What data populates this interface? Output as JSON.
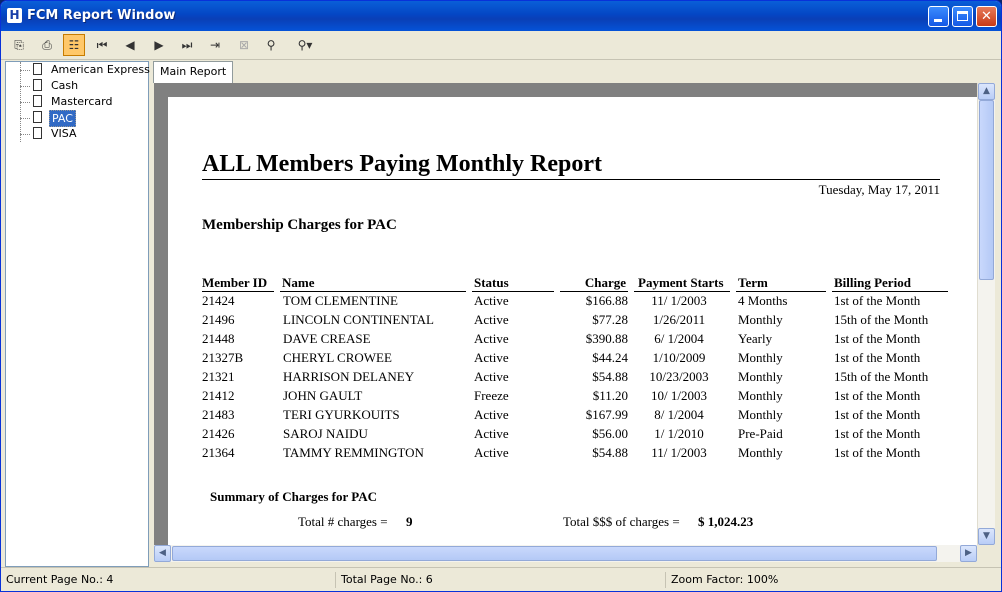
{
  "window": {
    "title": "FCM Report Window",
    "icon": "H"
  },
  "tree": {
    "items": [
      {
        "label": "American Express"
      },
      {
        "label": "Cash"
      },
      {
        "label": "Mastercard"
      },
      {
        "label": "PAC",
        "selected": true
      },
      {
        "label": "VISA"
      }
    ]
  },
  "tabs": [
    {
      "label": "Main Report"
    }
  ],
  "report": {
    "title": "ALL Members Paying Monthly Report",
    "date": "Tuesday, May 17, 2011",
    "section_title": "Membership Charges for PAC",
    "columns": [
      "Member ID",
      "Name",
      "Status",
      "Charge",
      "Payment Starts",
      "Term",
      "Billing Period"
    ],
    "rows": [
      [
        "21424",
        "TOM CLEMENTINE",
        "Active",
        "$166.88",
        "11/ 1/2003",
        "4 Months",
        "1st of the Month"
      ],
      [
        "21496",
        "LINCOLN CONTINENTAL",
        "Active",
        "$77.28",
        "1/26/2011",
        "Monthly",
        "15th of the Month"
      ],
      [
        "21448",
        "DAVE CREASE",
        "Active",
        "$390.88",
        "6/ 1/2004",
        "Yearly",
        "1st of the Month"
      ],
      [
        "21327B",
        "CHERYL CROWEE",
        "Active",
        "$44.24",
        "1/10/2009",
        "Monthly",
        "1st of the Month"
      ],
      [
        "21321",
        "HARRISON DELANEY",
        "Active",
        "$54.88",
        "10/23/2003",
        "Monthly",
        "15th of the Month"
      ],
      [
        "21412",
        "JOHN GAULT",
        "Freeze",
        "$11.20",
        "10/ 1/2003",
        "Monthly",
        "1st of the Month"
      ],
      [
        "21483",
        "TERI GYURKOUITS",
        "Active",
        "$167.99",
        "8/ 1/2004",
        "Monthly",
        "1st of the Month"
      ],
      [
        "21426",
        "SAROJ NAIDU",
        "Active",
        "$56.00",
        "1/ 1/2010",
        "Pre-Paid",
        "1st of the Month"
      ],
      [
        "21364",
        "TAMMY REMMINGTON",
        "Active",
        "$54.88",
        "11/ 1/2003",
        "Monthly",
        "1st of the Month"
      ]
    ],
    "summary": {
      "title": "Summary of Charges for PAC",
      "count_label": "Total # charges =",
      "count_value": "9",
      "total_label": "Total $$$ of charges =",
      "total_value": "$ 1,024.23"
    }
  },
  "status": {
    "current_page": "Current Page No.: 4",
    "total_page": "Total Page No.: 6",
    "zoom": "Zoom Factor: 100%"
  },
  "colors": {
    "title_bar": "#0a5fd8",
    "selection": "#316ac5",
    "active_tool": "#ffc869"
  }
}
